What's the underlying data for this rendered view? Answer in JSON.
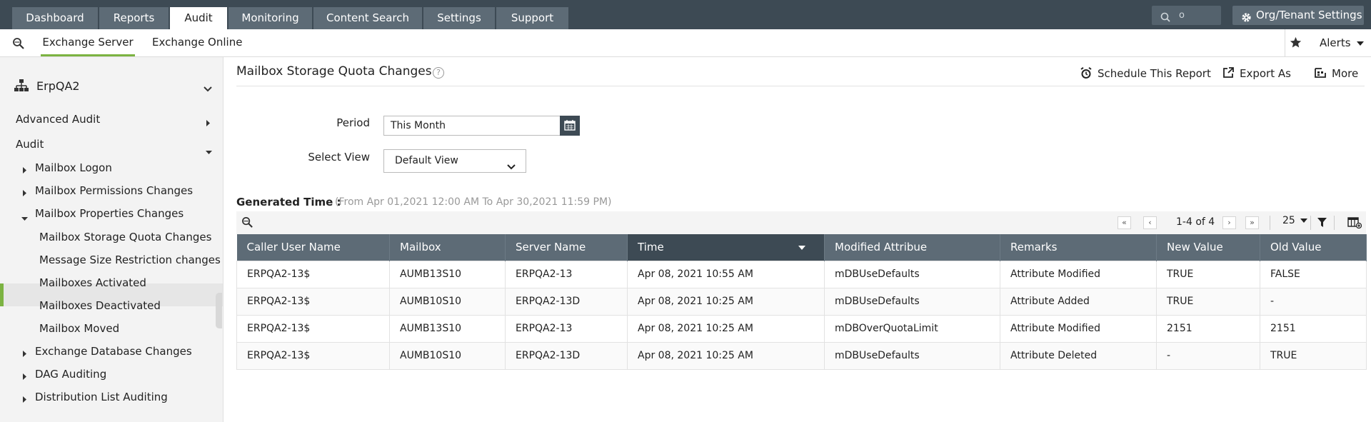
{
  "nav": {
    "tabs": [
      "Dashboard",
      "Reports",
      "Audit",
      "Monitoring",
      "Content Search",
      "Settings",
      "Support"
    ],
    "active_tab": "Audit",
    "search_placeholder": "o",
    "org_settings_label": "Org/Tenant Settings"
  },
  "subnav": {
    "tabs": [
      "Exchange Server",
      "Exchange Online"
    ],
    "active_tab": "Exchange Server",
    "alerts_label": "Alerts"
  },
  "sidebar": {
    "org_name": "ErpQA2",
    "sections": [
      "Advanced Audit",
      "Audit"
    ],
    "items": [
      "Mailbox Logon",
      "Mailbox Permissions Changes",
      "Mailbox Properties Changes",
      "Mailbox Storage Quota Changes",
      "Message Size Restriction changes",
      "Mailboxes Activated",
      "Mailboxes Deactivated",
      "Mailbox Moved",
      "Exchange Database Changes",
      "DAG Auditing",
      "Distribution List Auditing"
    ],
    "active_item": "Mailbox Storage Quota Changes"
  },
  "report": {
    "title": "Mailbox Storage Quota Changes",
    "actions": [
      "Schedule This Report",
      "Export As",
      "More"
    ],
    "period_label": "Period",
    "period_value": "This Month",
    "view_label": "Select View",
    "view_value": "Default View",
    "generated_label": "Generated Time :",
    "generated_range": "(From Apr 01,2021 12:00 AM To Apr 30,2021 11:59 PM)"
  },
  "pagination": {
    "range_text": "1-4 of 4",
    "page_size": "25"
  },
  "table": {
    "columns": [
      "Caller User Name",
      "Mailbox",
      "Server Name",
      "Time",
      "Modified Attribue",
      "Remarks",
      "New Value",
      "Old Value"
    ],
    "sorted_column": "Time",
    "rows": [
      [
        "ERPQA2-13$",
        "AUMB13S10",
        "ERPQA2-13",
        "Apr 08, 2021 10:55 AM",
        "mDBUseDefaults",
        "Attribute Modified",
        "TRUE",
        "FALSE"
      ],
      [
        "ERPQA2-13$",
        "AUMB10S10",
        "ERPQA2-13D",
        "Apr 08, 2021 10:25 AM",
        "mDBUseDefaults",
        "Attribute Added",
        "TRUE",
        "-"
      ],
      [
        "ERPQA2-13$",
        "AUMB13S10",
        "ERPQA2-13",
        "Apr 08, 2021 10:25 AM",
        "mDBOverQuotaLimit",
        "Attribute Modified",
        "2151",
        "2151"
      ],
      [
        "ERPQA2-13$",
        "AUMB10S10",
        "ERPQA2-13D",
        "Apr 08, 2021 10:25 AM",
        "mDBUseDefaults",
        "Attribute Deleted",
        "-",
        "TRUE"
      ]
    ]
  },
  "colors": {
    "topbar": "#3d4a54",
    "tab": "#5d6b76",
    "accent_green": "#7cb342",
    "header": "#5d6b76"
  }
}
